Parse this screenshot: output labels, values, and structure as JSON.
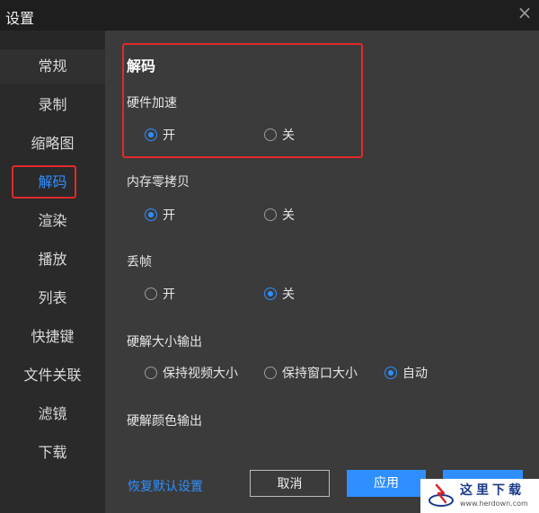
{
  "window": {
    "title": "设置"
  },
  "sidebar": {
    "items": [
      {
        "label": "常规"
      },
      {
        "label": "录制"
      },
      {
        "label": "缩略图"
      },
      {
        "label": "解码",
        "active": true
      },
      {
        "label": "渲染"
      },
      {
        "label": "播放"
      },
      {
        "label": "列表"
      },
      {
        "label": "快捷键"
      },
      {
        "label": "文件关联"
      },
      {
        "label": "滤镜"
      },
      {
        "label": "下载"
      }
    ]
  },
  "main": {
    "section_title": "解码",
    "hardware_accel": {
      "label": "硬件加速",
      "on": "开",
      "off": "关",
      "selected": "on"
    },
    "zero_copy": {
      "label": "内存零拷贝",
      "on": "开",
      "off": "关",
      "selected": "on"
    },
    "drop_frames": {
      "label": "丢帧",
      "on": "开",
      "off": "关",
      "selected": "off"
    },
    "hw_size_output": {
      "label": "硬解大小输出",
      "options": [
        "保持视频大小",
        "保持窗口大小",
        "自动"
      ],
      "selected": "自动"
    },
    "hw_color_output": {
      "label": "硬解颜色输出"
    }
  },
  "footer": {
    "restore_label": "恢复默认设置",
    "cancel_label": "取消",
    "apply_label": "应用"
  },
  "watermark": {
    "text": "这里下载",
    "url": "www.herdown.com"
  },
  "colors": {
    "accent": "#2f8fff",
    "highlight": "#e02a2a",
    "background": "#3b3b3b",
    "sidebar": "#2a2a2a"
  }
}
